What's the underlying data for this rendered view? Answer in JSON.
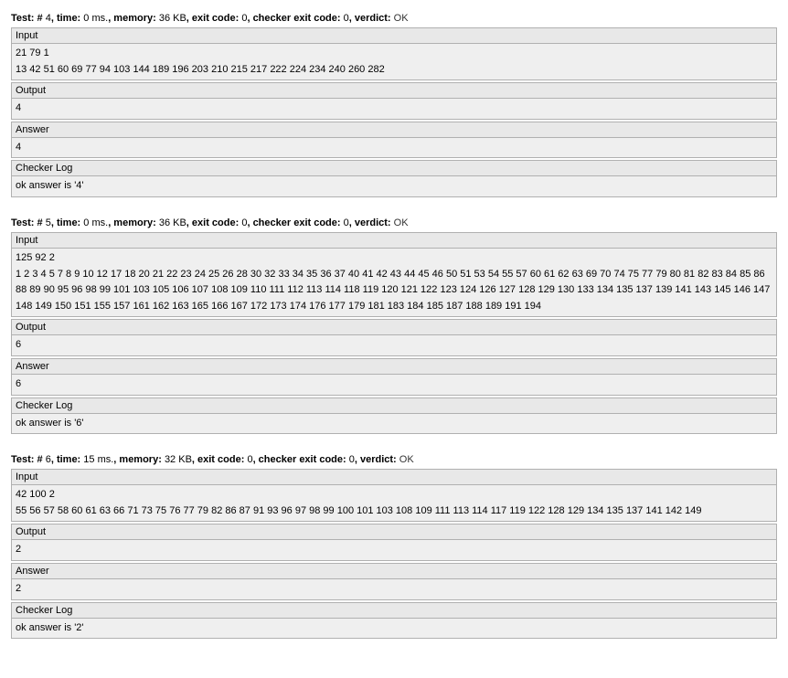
{
  "labels": {
    "test_prefix": "Test: #",
    "time_label": ", time: ",
    "memory_label": ", memory: ",
    "exit_code_label": ", exit code: ",
    "checker_exit_code_label": ", checker exit code: ",
    "verdict_label": ", verdict: ",
    "input": "Input",
    "output": "Output",
    "answer": "Answer",
    "checker_log": "Checker Log"
  },
  "tests": [
    {
      "num": "4",
      "time": "0 ms.",
      "memory": "36 KB",
      "exit_code": "0",
      "checker_exit_code": "0",
      "verdict": "OK",
      "input": "21 79 1\n13 42 51 60 69 77 94 103 144 189 196 203 210 215 217 222 224 234 240 260 282",
      "output": "4",
      "answer": "4",
      "checker_log": "ok answer is '4'"
    },
    {
      "num": "5",
      "time": "0 ms.",
      "memory": "36 KB",
      "exit_code": "0",
      "checker_exit_code": "0",
      "verdict": "OK",
      "input": "125 92 2\n1 2 3 4 5 7 8 9 10 12 17 18 20 21 22 23 24 25 26 28 30 32 33 34 35 36 37 40 41 42 43 44 45 46 50 51 53 54 55 57 60 61 62 63 69 70 74 75 77 79 80 81 82 83 84 85 86 88 89 90 95 96 98 99 101 103 105 106 107 108 109 110 111 112 113 114 118 119 120 121 122 123 124 126 127 128 129 130 133 134 135 137 139 141 143 145 146 147 148 149 150 151 155 157 161 162 163 165 166 167 172 173 174 176 177 179 181 183 184 185 187 188 189 191 194",
      "output": "6",
      "answer": "6",
      "checker_log": "ok answer is '6'"
    },
    {
      "num": "6",
      "time": "15 ms.",
      "memory": "32 KB",
      "exit_code": "0",
      "checker_exit_code": "0",
      "verdict": "OK",
      "input": "42 100 2\n55 56 57 58 60 61 63 66 71 73 75 76 77 79 82 86 87 91 93 96 97 98 99 100 101 103 108 109 111 113 114 117 119 122 128 129 134 135 137 141 142 149",
      "output": "2",
      "answer": "2",
      "checker_log": "ok answer is '2'"
    }
  ]
}
